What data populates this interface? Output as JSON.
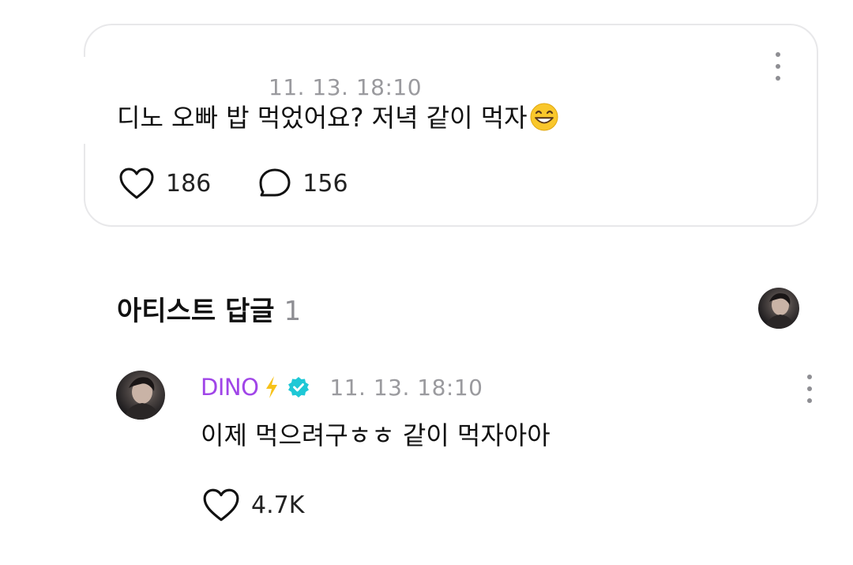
{
  "post": {
    "timestamp": "11. 13. 18:10",
    "text": "디노 오빠 밥 먹었어요?  저녁 같이 먹자",
    "emoji_icon": "grinning-face-emoji",
    "like_count": "186",
    "comment_count": "156"
  },
  "artist_replies": {
    "title": "아티스트 답글",
    "count": "1"
  },
  "reply": {
    "author": "DINO",
    "author_color": "#a045e8",
    "badge_icons": [
      "lightning-icon",
      "verified-icon"
    ],
    "timestamp": "11. 13. 18:10",
    "text": "이제 먹으려구ㅎㅎ 같이 먹자아아",
    "like_count": "4.7K"
  }
}
